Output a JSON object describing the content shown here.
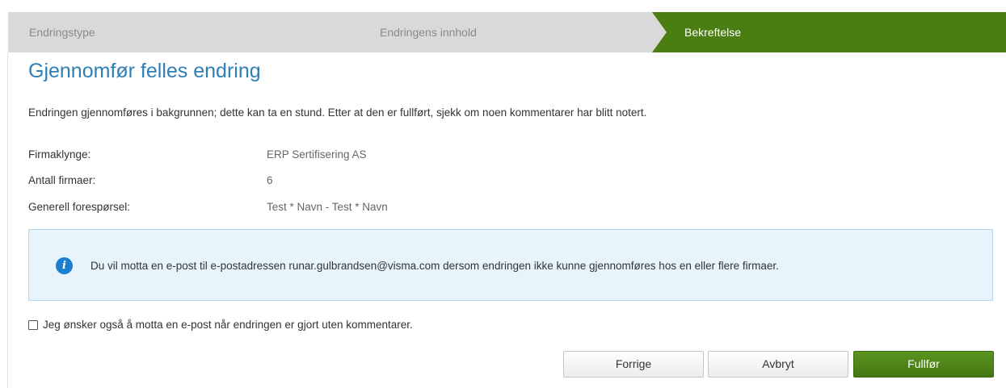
{
  "wizard": {
    "steps": [
      {
        "label": "Endringstype"
      },
      {
        "label": "Endringens innhold"
      },
      {
        "label": "Bekreftelse"
      }
    ],
    "active_color": "#4a7e12"
  },
  "page": {
    "title": "Gjennomfør felles endring",
    "intro": "Endringen gjennomføres i bakgrunnen; dette kan ta en stund. Etter at den er fullført, sjekk om noen kommentarer har blitt notert."
  },
  "details": [
    {
      "label": "Firmaklynge:",
      "value": "ERP Sertifisering AS"
    },
    {
      "label": "Antall firmaer:",
      "value": "6"
    },
    {
      "label": "Generell forespørsel:",
      "value": "Test * Navn - Test * Navn"
    }
  ],
  "info": {
    "icon": "info-icon",
    "text": "Du vil motta en e-post til e-postadressen runar.gulbrandsen@visma.com dersom endringen ikke kunne gjennomføres hos en eller flere firmaer."
  },
  "checkbox": {
    "label": "Jeg ønsker også å motta en e-post når endringen er gjort uten kommentarer.",
    "checked": false
  },
  "buttons": {
    "previous": "Forrige",
    "cancel": "Avbryt",
    "finish": "Fullfør"
  }
}
